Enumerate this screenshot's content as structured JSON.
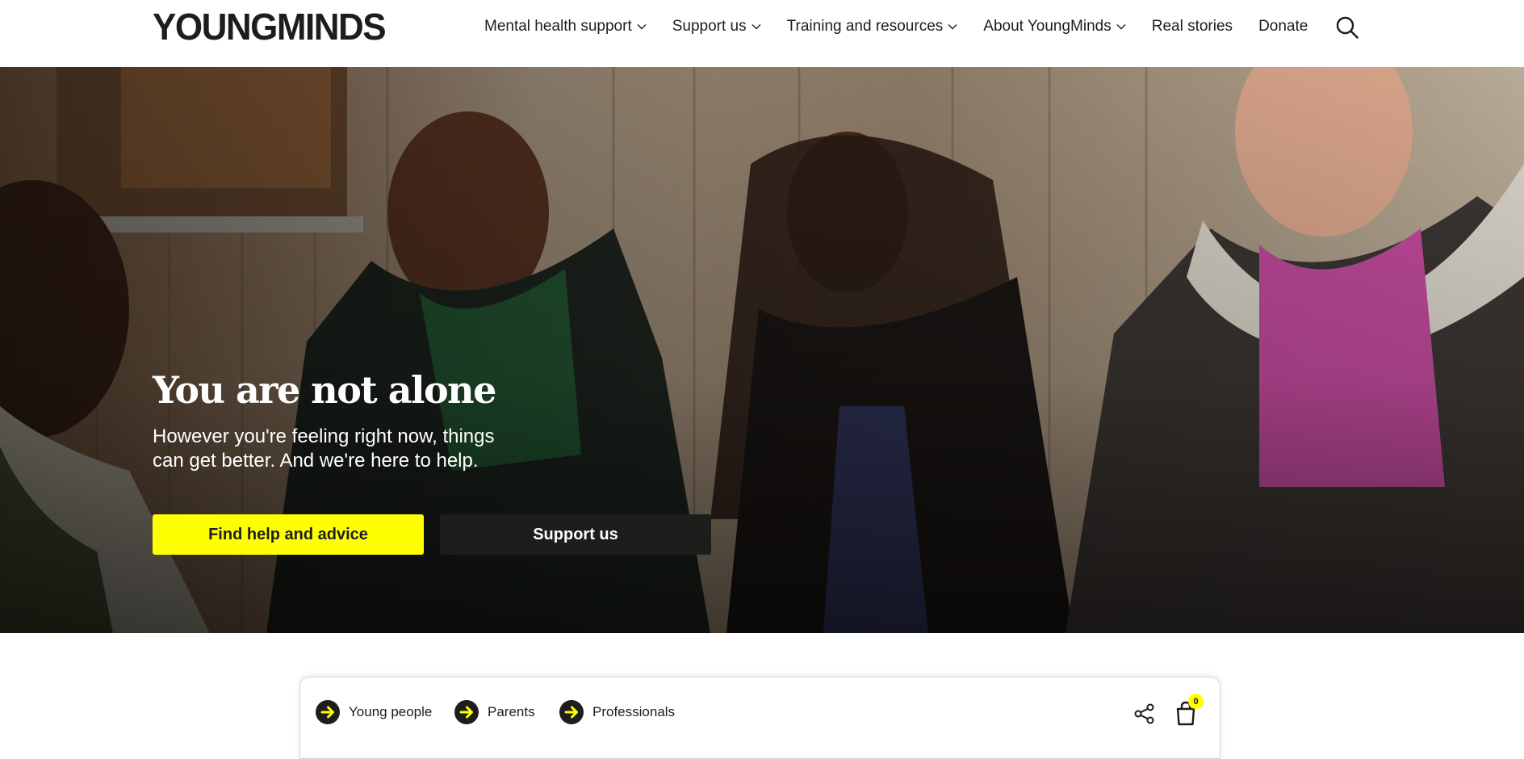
{
  "brand": {
    "logo_text": "YOUNGMINDS"
  },
  "nav": {
    "items": [
      {
        "label": "Mental health support",
        "has_dropdown": true
      },
      {
        "label": "Support us",
        "has_dropdown": true
      },
      {
        "label": "Training and resources",
        "has_dropdown": true
      },
      {
        "label": "About YoungMinds",
        "has_dropdown": true
      },
      {
        "label": "Real stories",
        "has_dropdown": false
      },
      {
        "label": "Donate",
        "has_dropdown": false
      }
    ],
    "search_icon": "search-icon"
  },
  "hero": {
    "title": "You are not alone",
    "subtitle": "However you're feeling right now, things can get better. And we're here to help.",
    "primary_button": "Find help and advice",
    "secondary_button": "Support us"
  },
  "quickbar": {
    "links": [
      {
        "label": "Young people",
        "icon": "arrow-right-circle-icon"
      },
      {
        "label": "Parents",
        "icon": "arrow-right-circle-icon"
      },
      {
        "label": "Professionals",
        "icon": "arrow-right-circle-icon"
      }
    ],
    "share_icon": "share-icon",
    "basket_icon": "basket-icon",
    "basket_count": "0"
  },
  "colors": {
    "accent_yellow": "#ffff00",
    "dark": "#1d1d1b",
    "white": "#ffffff"
  }
}
